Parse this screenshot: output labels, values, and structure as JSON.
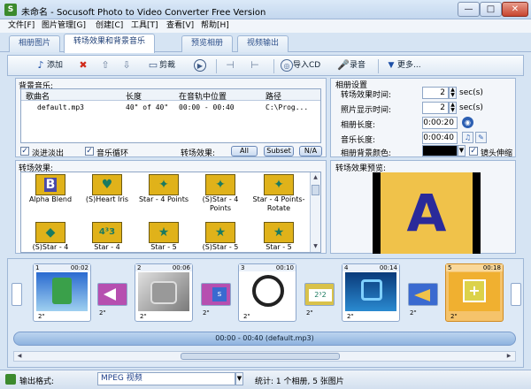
{
  "window": {
    "title": "未命名 - Socusoft Photo to Video Converter Free Version",
    "app_icon_glyph": "S",
    "min_glyph": "—",
    "max_glyph": "□",
    "close_glyph": "✕"
  },
  "menu": [
    "文件[F]",
    "图片管理[G]",
    "创建[C]",
    "工具[T]",
    "查看[V]",
    "帮助[H]"
  ],
  "tabs": [
    "相册图片",
    "转场效果和背景音乐",
    "预览相册",
    "视频输出"
  ],
  "active_tab_index": 1,
  "toolbar": {
    "add": "添加",
    "crop": "剪裁",
    "import_cd": "导入CD",
    "record": "录音",
    "more": "更多..."
  },
  "music": {
    "label": "背景音乐:",
    "columns": [
      "歌曲名",
      "长度",
      "在音轨中位置",
      "路径"
    ],
    "rows": [
      {
        "name": "default.mp3",
        "length": "40\" of 40\"",
        "position": "00:00 - 00:40",
        "path": "C:\\Prog..."
      }
    ],
    "fade_label": "淡进淡出",
    "fade_checked": true,
    "loop_label": "音乐循环",
    "loop_checked": true,
    "effect_label": "转场效果:",
    "effect_buttons": [
      "All",
      "Subset",
      "N/A"
    ]
  },
  "album": {
    "label": "相册设置",
    "trans_time_label": "转场效果时间:",
    "trans_time_value": "2",
    "trans_time_unit": "sec(s)",
    "photo_time_label": "照片显示时间:",
    "photo_time_value": "2",
    "photo_time_unit": "sec(s)",
    "album_len_label": "相册长度:",
    "album_len_value": "0:00:20",
    "music_len_label": "音乐长度:",
    "music_len_value": "0:00:40",
    "bg_color_label": "相册背景颜色:",
    "bg_color": "#000000",
    "zoom_label": "镜头伸缩",
    "zoom_checked": true
  },
  "effects": {
    "label": "转场效果:",
    "items": [
      {
        "name": "Alpha Blend",
        "glyph": "B"
      },
      {
        "name": "(S)Heart Iris",
        "glyph": "♥"
      },
      {
        "name": "Star - 4 Points",
        "glyph": "✦"
      },
      {
        "name": "(S)Star - 4 Points",
        "glyph": "✦"
      },
      {
        "name": "Star - 4 Points-Rotate",
        "glyph": "✦"
      },
      {
        "name": "(S)Star - 4",
        "glyph": "◆"
      },
      {
        "name": "Star - 4",
        "glyph": "4³3"
      },
      {
        "name": "Star - 5",
        "glyph": "★"
      },
      {
        "name": "(S)Star - 5",
        "glyph": "★"
      },
      {
        "name": "Star - 5",
        "glyph": "★"
      }
    ]
  },
  "preview": {
    "label": "转场效果预览:",
    "letter": "A"
  },
  "timeline": {
    "slides": [
      {
        "num": "1",
        "time": "00:02",
        "dur": "2\""
      },
      {
        "num": "2",
        "time": "00:06",
        "dur": "2\""
      },
      {
        "num": "3",
        "time": "00:10",
        "dur": "2\""
      },
      {
        "num": "4",
        "time": "00:14",
        "dur": "2\""
      },
      {
        "num": "5",
        "time": "00:18",
        "dur": "2\""
      }
    ],
    "trans_durs": [
      "2\"",
      "2\"",
      "2\"",
      "2\"",
      "2\""
    ],
    "music_bar": "00:00 - 00:40 (default.mp3)"
  },
  "status": {
    "format_label": "输出格式:",
    "format_value": "MPEG 视频",
    "stats": "统计: 1 个相册, 5 张图片"
  },
  "colors": {
    "accent": "#2b4f8a",
    "tile": "#e0b21a",
    "selected_slide": "#f5c36b",
    "preview_bg": "#f0c24a"
  }
}
